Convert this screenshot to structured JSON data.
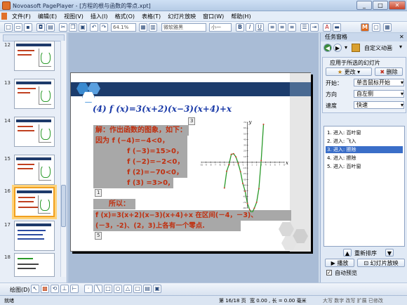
{
  "window": {
    "title": "Novoasoft PagePlayer - [方程的根与函数的零点.xpt]",
    "controls": [
      "_",
      "□",
      "✕"
    ]
  },
  "menu": [
    "文件(F)",
    "编辑(E)",
    "视图(V)",
    "插入(I)",
    "格式(O)",
    "表格(T)",
    "幻灯片放映",
    "窗口(W)",
    "帮助(H)"
  ],
  "toolbar": {
    "zoom": "64.1%",
    "font_name": "微软雅黑",
    "font_size": "小一"
  },
  "thumbnails": {
    "numbers": [
      "12",
      "13",
      "14",
      "15",
      "16",
      "17",
      "18"
    ],
    "selected_index": 4
  },
  "slide": {
    "heading": "(4) f (x)=3(x+2)(x−3)(x+4)+x",
    "marker3": "3",
    "solution_intro": "解：作出函数的图象，如下：",
    "line1": "因为  f (−4)=−4<0，",
    "line2": "f (−3)=15>0，",
    "line3": "f (−2)=−2<0，",
    "line4": "f (2)=−70<0，",
    "line5": "f (3) =3>0,",
    "marker1": "1",
    "therefore": "所以：",
    "conclusion1": "f (x)=3(x+2)(x−3)(x+4)+x 在区间(－4，－3)、",
    "conclusion2": "(－3，-2)、(2，3)上各有一个零点.",
    "marker5": "5",
    "axis_labels": {
      "x": "x",
      "y": "y"
    },
    "x_ticks": [
      "-10",
      "-9",
      "-8",
      "-7",
      "-6",
      "-5",
      "-4",
      "-3",
      "-2",
      "-1",
      "0",
      "1",
      "2",
      "3",
      "4",
      "5",
      "6",
      "7",
      "8"
    ],
    "y_ticks": [
      "70",
      "60",
      "50",
      "40",
      "30",
      "20",
      "10",
      "-10",
      "-20",
      "-30",
      "-40",
      "-50",
      "-60",
      "-70",
      "-80"
    ]
  },
  "chart_data": {
    "type": "line",
    "title": "",
    "xlabel": "x",
    "ylabel": "y",
    "xlim": [
      -10,
      8
    ],
    "ylim": [
      -80,
      70
    ],
    "series": [
      {
        "x": [
          -5,
          -4.5,
          -4,
          -3.5,
          -3,
          -2.5,
          -2,
          -1.5,
          -1,
          -0.5,
          0,
          0.5,
          1,
          1.5,
          2,
          2.5,
          3,
          3.5
        ],
        "values": [
          -45,
          -15.6,
          -4,
          13.9,
          15,
          9.4,
          -2,
          -16.3,
          -37,
          -50.6,
          -72,
          -83.1,
          -89,
          -80.3,
          -70,
          -46.2,
          3,
          66.4
        ]
      }
    ],
    "points": [
      {
        "x": -4,
        "y": -4
      },
      {
        "x": -3,
        "y": 15
      },
      {
        "x": -2,
        "y": -2
      },
      {
        "x": 2,
        "y": -70
      },
      {
        "x": 3,
        "y": 3
      }
    ]
  },
  "task_pane": {
    "header": "任务窗格",
    "nav_title": "自定义动画",
    "apply_label": "应用于所选的幻灯片",
    "change_button": "更改",
    "delete_button": "删除",
    "start_label": "开始：",
    "start_value": "单击鼠标开始",
    "direction_label": "方向",
    "direction_value": "自左侧",
    "speed_label": "速度",
    "speed_value": "快速",
    "animations": [
      "1. 进入: 百叶窗",
      "2. 进入: 飞入",
      "3. 进入: 擦除",
      "4. 进入: 擦除",
      "5. 进入: 百叶窗"
    ],
    "selected_anim": 2,
    "reorder_label": "重新排序",
    "play_button": "播放",
    "slideshow_button": "幻灯片放映",
    "autopreview_label": "自动预览"
  },
  "drawbar": {
    "label": "绘图(D)"
  },
  "status": {
    "left": "就绪",
    "slide_pos": "第 16/18 页",
    "coords": "宽 0.00 , 长 = 0.00 毫米",
    "indicators": "大写  数字  改写  扩展  已修改"
  }
}
